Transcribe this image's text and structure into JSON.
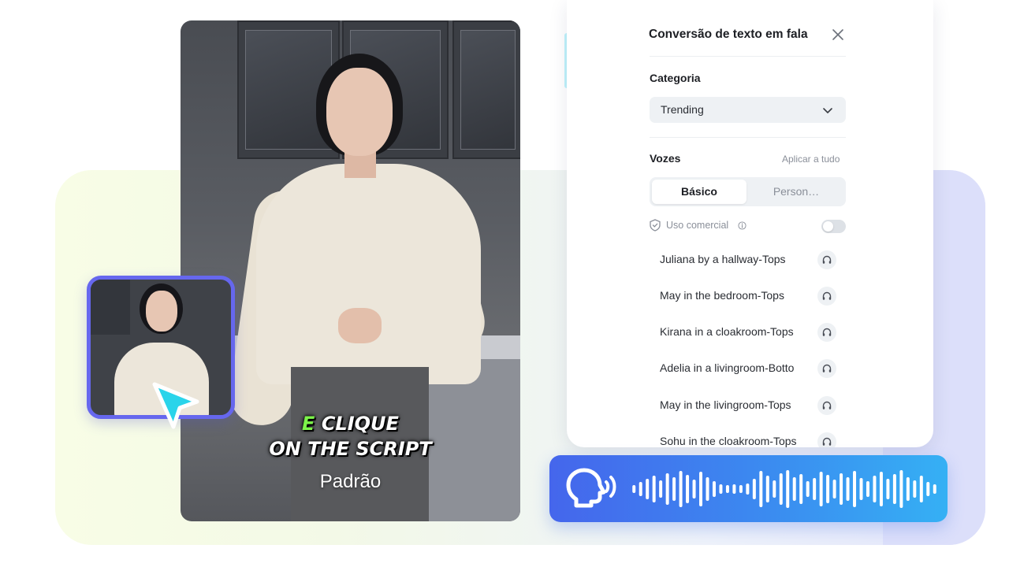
{
  "video": {
    "caption_word1": "E",
    "caption_word2": "CLIQUE",
    "caption_line2": "ON THE SCRIPT",
    "subtitle": "Padrão"
  },
  "panel": {
    "title": "Conversão de texto em fala",
    "category_label": "Categoria",
    "category_value": "Trending",
    "voices_label": "Vozes",
    "apply_all": "Aplicar a tudo",
    "tabs": [
      {
        "label": "Básico",
        "active": true
      },
      {
        "label": "Person…",
        "active": false
      }
    ],
    "commercial_label": "Uso comercial",
    "commercial_enabled": false,
    "voices": [
      {
        "name": "Juliana by a hallway-Tops"
      },
      {
        "name": "May in the bedroom-Tops"
      },
      {
        "name": "Kirana in a cloakroom-Tops"
      },
      {
        "name": "Adelia in a livingroom-Botto"
      },
      {
        "name": "May in the livingroom-Tops"
      },
      {
        "name": "Sohu in the cloakroom-Tops"
      }
    ]
  },
  "colors": {
    "accent": "#6667ee",
    "wave_start": "#4566ec",
    "wave_end": "#35b0f4",
    "cursor": "#2ad4ea"
  },
  "icons": {
    "close": "close-icon",
    "dropdown": "chevron-down-icon",
    "shield": "shield-icon",
    "info": "info-icon",
    "play": "headphones-icon",
    "speech": "speaking-head-icon",
    "pointer": "cursor-pointer-icon"
  }
}
